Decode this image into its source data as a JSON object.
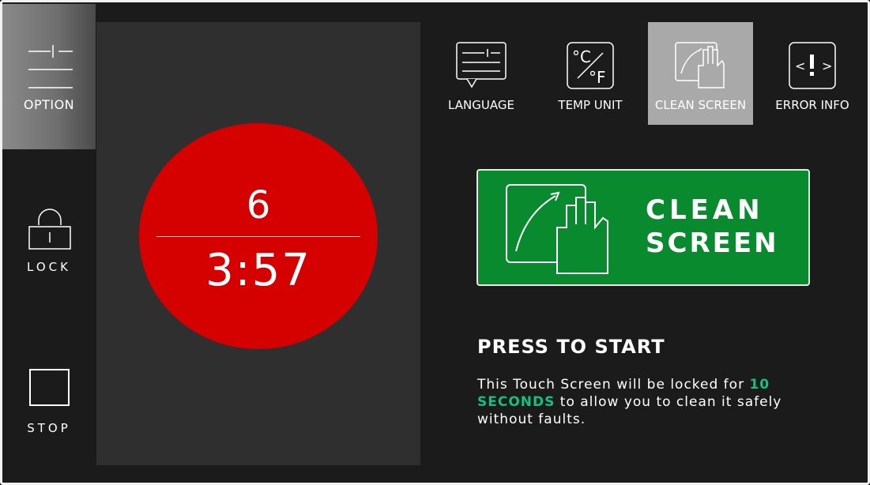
{
  "sidebar": {
    "option_label": "OPTION",
    "lock_label": "LOCK",
    "stop_label": "STOP"
  },
  "timer": {
    "top_value": "6",
    "bottom_value": "3:57",
    "color": "#d50000"
  },
  "tabs": [
    {
      "label": "LANGUAGE",
      "icon": "language-icon"
    },
    {
      "label": "TEMP UNIT",
      "icon": "temp-unit-icon"
    },
    {
      "label": "CLEAN SCREEN",
      "icon": "clean-screen-icon",
      "selected": true
    },
    {
      "label": "ERROR INFO",
      "icon": "error-info-icon"
    }
  ],
  "temp_icon": {
    "c": "°C",
    "f": "°F"
  },
  "clean_button": {
    "line1": "CLEAN",
    "line2": "SCREEN",
    "color": "#098a2f"
  },
  "info": {
    "heading": "PRESS TO START",
    "desc_before": "This Touch Screen will be locked for ",
    "desc_highlight": "10 SECONDS",
    "desc_after": " to allow you to clean it safely without faults.",
    "highlight_color": "#14c080"
  }
}
